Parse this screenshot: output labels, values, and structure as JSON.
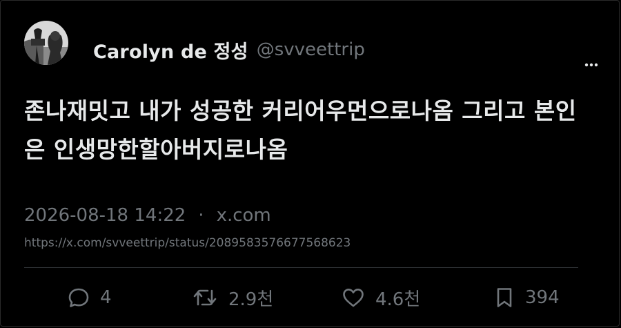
{
  "author": {
    "display_name": "Carolyn de 정성",
    "handle": "@svveettrip"
  },
  "tweet": {
    "text": "존나재밋고 내가 성공한 커리어우먼으로나옴 그리고 본인은 인생망한할아버지로나옴"
  },
  "meta": {
    "timestamp": "2026-08-18 14:22",
    "separator": "·",
    "source": "x.com",
    "url": "https://x.com/svveettrip/status/2089583576677568623"
  },
  "actions": {
    "replies": "4",
    "reposts": "2.9천",
    "likes": "4.6천",
    "bookmarks": "394"
  },
  "icons": {
    "more": "more-horizontal-icon",
    "reply": "reply-icon",
    "repost": "repost-icon",
    "like": "heart-icon",
    "bookmark": "bookmark-icon"
  },
  "colors": {
    "background": "#000000",
    "primary_text": "#e7e9ea",
    "secondary_text": "#71767b",
    "divider": "#2f3336"
  }
}
